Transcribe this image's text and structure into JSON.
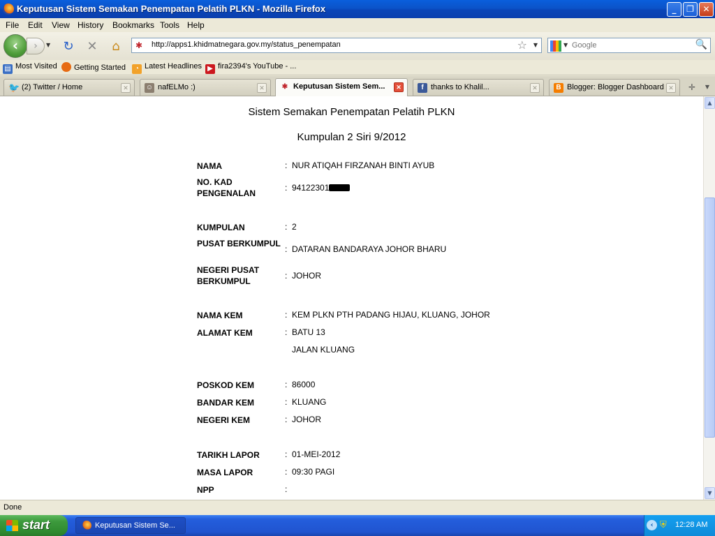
{
  "window": {
    "title": "Keputusan Sistem Semakan Penempatan Pelatih PLKN - Mozilla Firefox"
  },
  "menu": [
    "File",
    "Edit",
    "View",
    "History",
    "Bookmarks",
    "Tools",
    "Help"
  ],
  "nav": {
    "url": "http://apps1.khidmatnegara.gov.my/status_penempatan",
    "search_placeholder": "Google"
  },
  "bookmarks": [
    {
      "label": "Most Visited",
      "icon": "most-visited-icon"
    },
    {
      "label": "Getting Started",
      "icon": "firefox-icon"
    },
    {
      "label": "Latest Headlines",
      "icon": "rss-icon"
    },
    {
      "label": "fira2394's YouTube - ...",
      "icon": "youtube-icon"
    }
  ],
  "tabs": [
    {
      "label": "(2) Twitter / Home",
      "icon": "twitter-icon",
      "active": false
    },
    {
      "label": "nafELMo :)",
      "icon": "avatar-icon",
      "active": false
    },
    {
      "label": "Keputusan Sistem Sem...",
      "icon": "plkn-icon",
      "active": true
    },
    {
      "label": "thanks to Khalil...",
      "icon": "facebook-icon",
      "active": false
    },
    {
      "label": "Blogger: Blogger Dashboard",
      "icon": "blogger-icon",
      "active": false
    }
  ],
  "page": {
    "heading": "Sistem Semakan Penempatan Pelatih PLKN",
    "subheading": "Kumpulan 2 Siri 9/2012",
    "separator": ":",
    "fields": {
      "nama": {
        "label": "NAMA",
        "value": "NUR ATIQAH FIRZANAH BINTI AYUB"
      },
      "ic": {
        "label": "NO. KAD PENGENALAN",
        "value": "94122301"
      },
      "kumpulan": {
        "label": "KUMPULAN",
        "value": "2"
      },
      "pusat": {
        "label": "PUSAT BERKUMPUL",
        "value": "DATARAN BANDARAYA JOHOR BHARU"
      },
      "negeri_pusat": {
        "label": "NEGERI PUSAT BERKUMPUL",
        "value": "JOHOR"
      },
      "nama_kem": {
        "label": "NAMA KEM",
        "value": "KEM PLKN PTH PADANG HIJAU, KLUANG, JOHOR"
      },
      "alamat_kem": {
        "label": "ALAMAT KEM",
        "value_line1": "BATU 13",
        "value_line2": "JALAN KLUANG"
      },
      "poskod": {
        "label": "POSKOD KEM",
        "value": "86000"
      },
      "bandar": {
        "label": "BANDAR KEM",
        "value": "KLUANG"
      },
      "negeri_kem": {
        "label": "NEGERI KEM",
        "value": "JOHOR"
      },
      "tarikh": {
        "label": "TARIKH LAPOR",
        "value": "01-MEI-2012"
      },
      "masa": {
        "label": "MASA LAPOR",
        "value": "09:30 PAGI"
      },
      "npp": {
        "label": "NPP",
        "value": ""
      }
    }
  },
  "status": {
    "text": "Done"
  },
  "taskbar": {
    "start": "start",
    "item": "Keputusan Sistem Se...",
    "clock": "12:28 AM"
  },
  "colors": {
    "titlebar": "#0b53c9",
    "taskbar": "#245edc",
    "start": "#3d9a3d",
    "active_tab_close": "#e4503a"
  }
}
